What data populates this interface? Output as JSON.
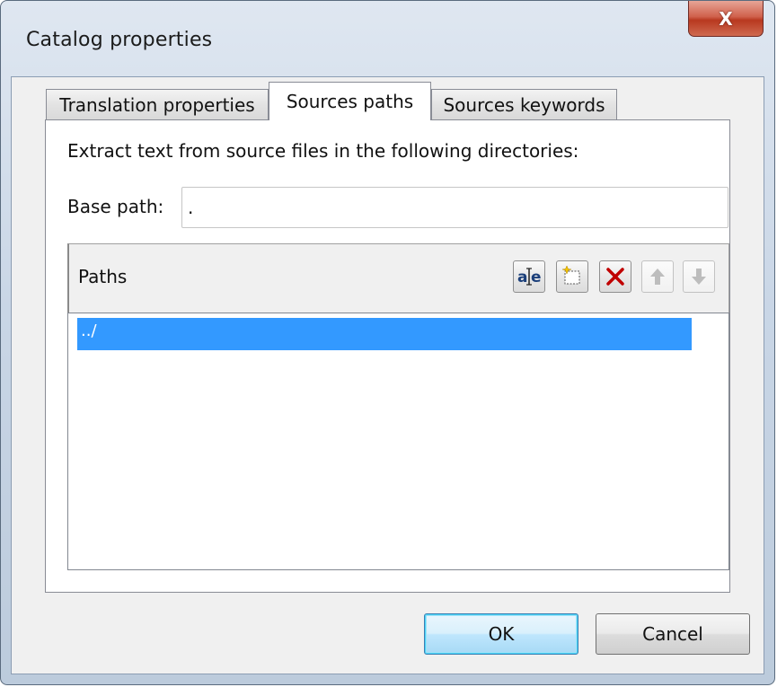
{
  "window": {
    "title": "Catalog properties",
    "close_glyph": "X"
  },
  "tabs": [
    {
      "label": "Translation properties",
      "active": false
    },
    {
      "label": "Sources paths",
      "active": true
    },
    {
      "label": "Sources keywords",
      "active": false
    }
  ],
  "sources_paths": {
    "description": "Extract text from source files in the following directories:",
    "base_path_label": "Base path:",
    "base_path_value": ".",
    "list_header": "Paths",
    "toolbar": [
      {
        "name": "edit-item-icon",
        "enabled": true
      },
      {
        "name": "new-item-icon",
        "enabled": true
      },
      {
        "name": "delete-icon",
        "enabled": true
      },
      {
        "name": "move-up-icon",
        "enabled": false
      },
      {
        "name": "move-down-icon",
        "enabled": false
      }
    ],
    "paths": [
      {
        "value": "../",
        "selected": true
      }
    ]
  },
  "buttons": {
    "ok_label": "OK",
    "cancel_label": "Cancel"
  },
  "colors": {
    "selection": "#3399ff",
    "delete_red": "#c00000",
    "default_button_border": "#3c7fb1"
  }
}
